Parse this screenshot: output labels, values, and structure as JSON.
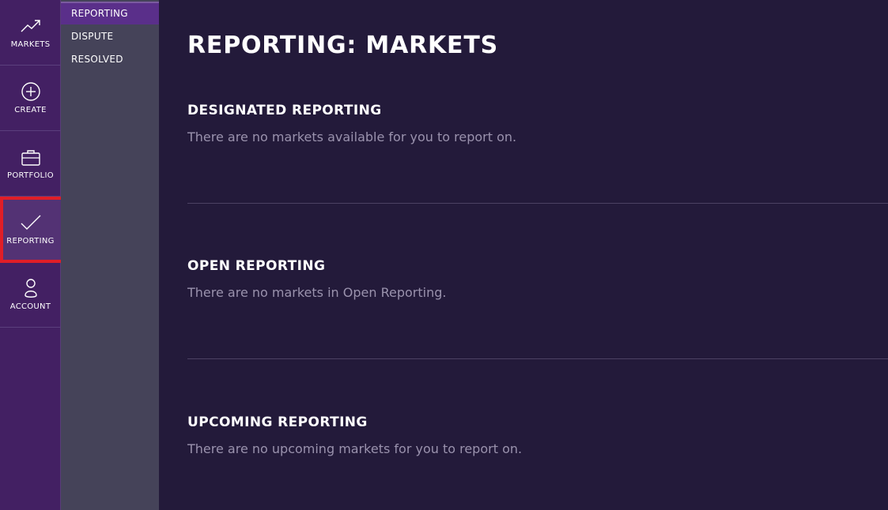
{
  "rail": {
    "items": [
      {
        "label": "MARKETS",
        "icon": "trending-up-icon"
      },
      {
        "label": "CREATE",
        "icon": "plus-circle-icon"
      },
      {
        "label": "PORTFOLIO",
        "icon": "briefcase-icon"
      },
      {
        "label": "REPORTING",
        "icon": "checkmark-icon"
      },
      {
        "label": "ACCOUNT",
        "icon": "user-icon"
      }
    ],
    "active": "REPORTING",
    "highlight_color": "#e01e27"
  },
  "subnav": {
    "items": [
      {
        "label": "REPORTING"
      },
      {
        "label": "DISPUTE"
      },
      {
        "label": "RESOLVED"
      }
    ],
    "active": "REPORTING"
  },
  "main": {
    "title": "REPORTING: MARKETS",
    "sections": [
      {
        "title": "DESIGNATED REPORTING",
        "message": "There are no markets available for you to report on."
      },
      {
        "title": "OPEN REPORTING",
        "message": "There are no markets in Open Reporting."
      },
      {
        "title": "UPCOMING REPORTING",
        "message": "There are no upcoming markets for you to report on."
      }
    ]
  },
  "colors": {
    "rail_bg": "#432063",
    "subnav_bg": "#454359",
    "subnav_active": "#5a2f8a",
    "main_bg": "#231a3a",
    "muted_text": "#9a92ad"
  }
}
